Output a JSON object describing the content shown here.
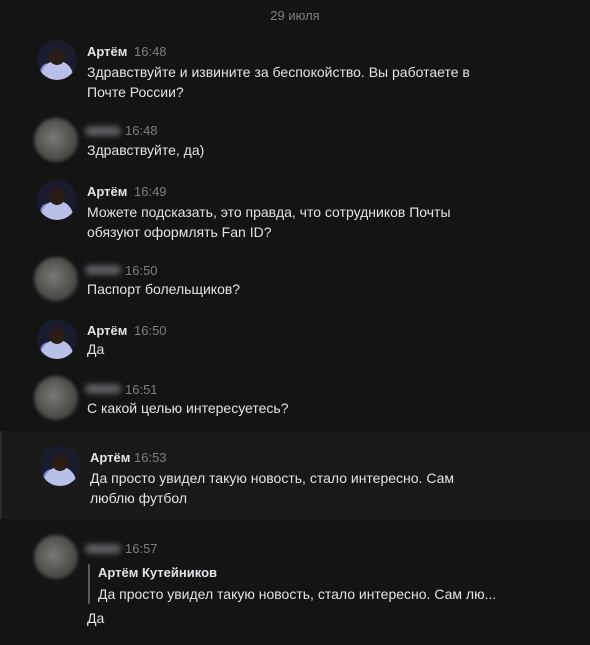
{
  "date_divider": "29 июля",
  "messages": [
    {
      "author": "Артём",
      "time": "16:48",
      "text": "Здравствуйте и извините за беспокойство. Вы работаете в Почте России?"
    },
    {
      "author": "",
      "time": "16:48",
      "text": "Здравствуйте, да)"
    },
    {
      "author": "Артём",
      "time": "16:49",
      "text": "Можете подсказать, это правда, что сотрудников Почты обязуют оформлять Fan ID?"
    },
    {
      "author": "",
      "time": "16:50",
      "text": "Паспорт болельщиков?"
    },
    {
      "author": "Артём",
      "time": "16:50",
      "text": "Да"
    },
    {
      "author": "",
      "time": "16:51",
      "text": "С какой целью интересуетесь?"
    },
    {
      "author": "Артём",
      "time": "16:53",
      "text": "Да просто увидел такую новость, стало интересно. Сам люблю футбол"
    },
    {
      "author": "",
      "time": "16:57",
      "text": "Да",
      "reply": {
        "author": "Артём Кутейников",
        "text": "Да просто увидел такую новость, стало интересно. Сам лю..."
      }
    }
  ]
}
